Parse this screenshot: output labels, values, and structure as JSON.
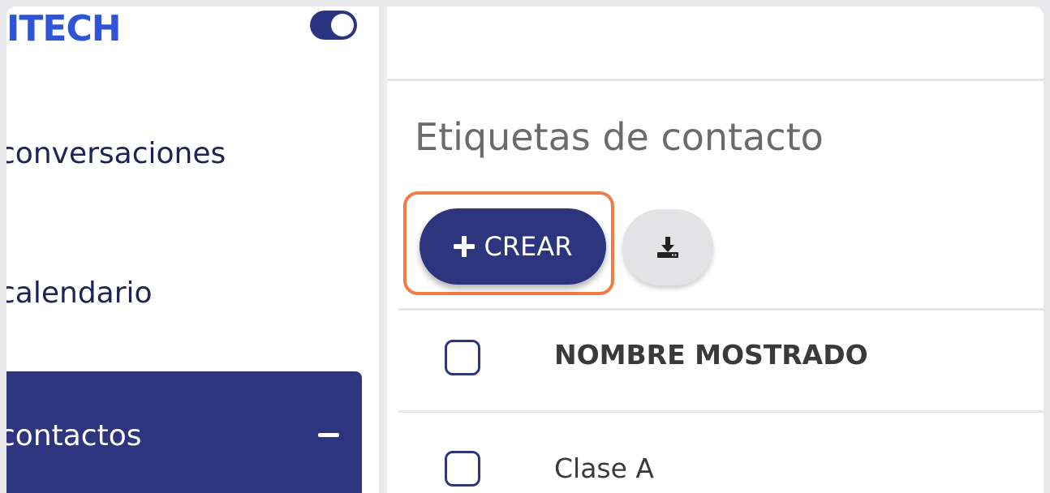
{
  "sidebar": {
    "logo_text": "ITECH",
    "toggle_state": "on",
    "items": [
      {
        "label": "conversaciones",
        "icon": "none"
      },
      {
        "label": "calendario",
        "icon": "none"
      },
      {
        "label": "contactos",
        "icon": "minus-icon",
        "active": true
      }
    ]
  },
  "main": {
    "title": "Etiquetas de contacto",
    "create_button": {
      "label": "CREAR",
      "icon": "plus-icon"
    },
    "export_button": {
      "icon": "download-icon"
    },
    "table": {
      "columns": [
        "NOMBRE MOSTRADO"
      ],
      "rows": [
        {
          "name": "Clase A"
        }
      ]
    }
  },
  "colors": {
    "primary": "#2c357e",
    "logo": "#2f55d4",
    "highlight": "#f07c46",
    "title_text": "#6b6b6b"
  }
}
